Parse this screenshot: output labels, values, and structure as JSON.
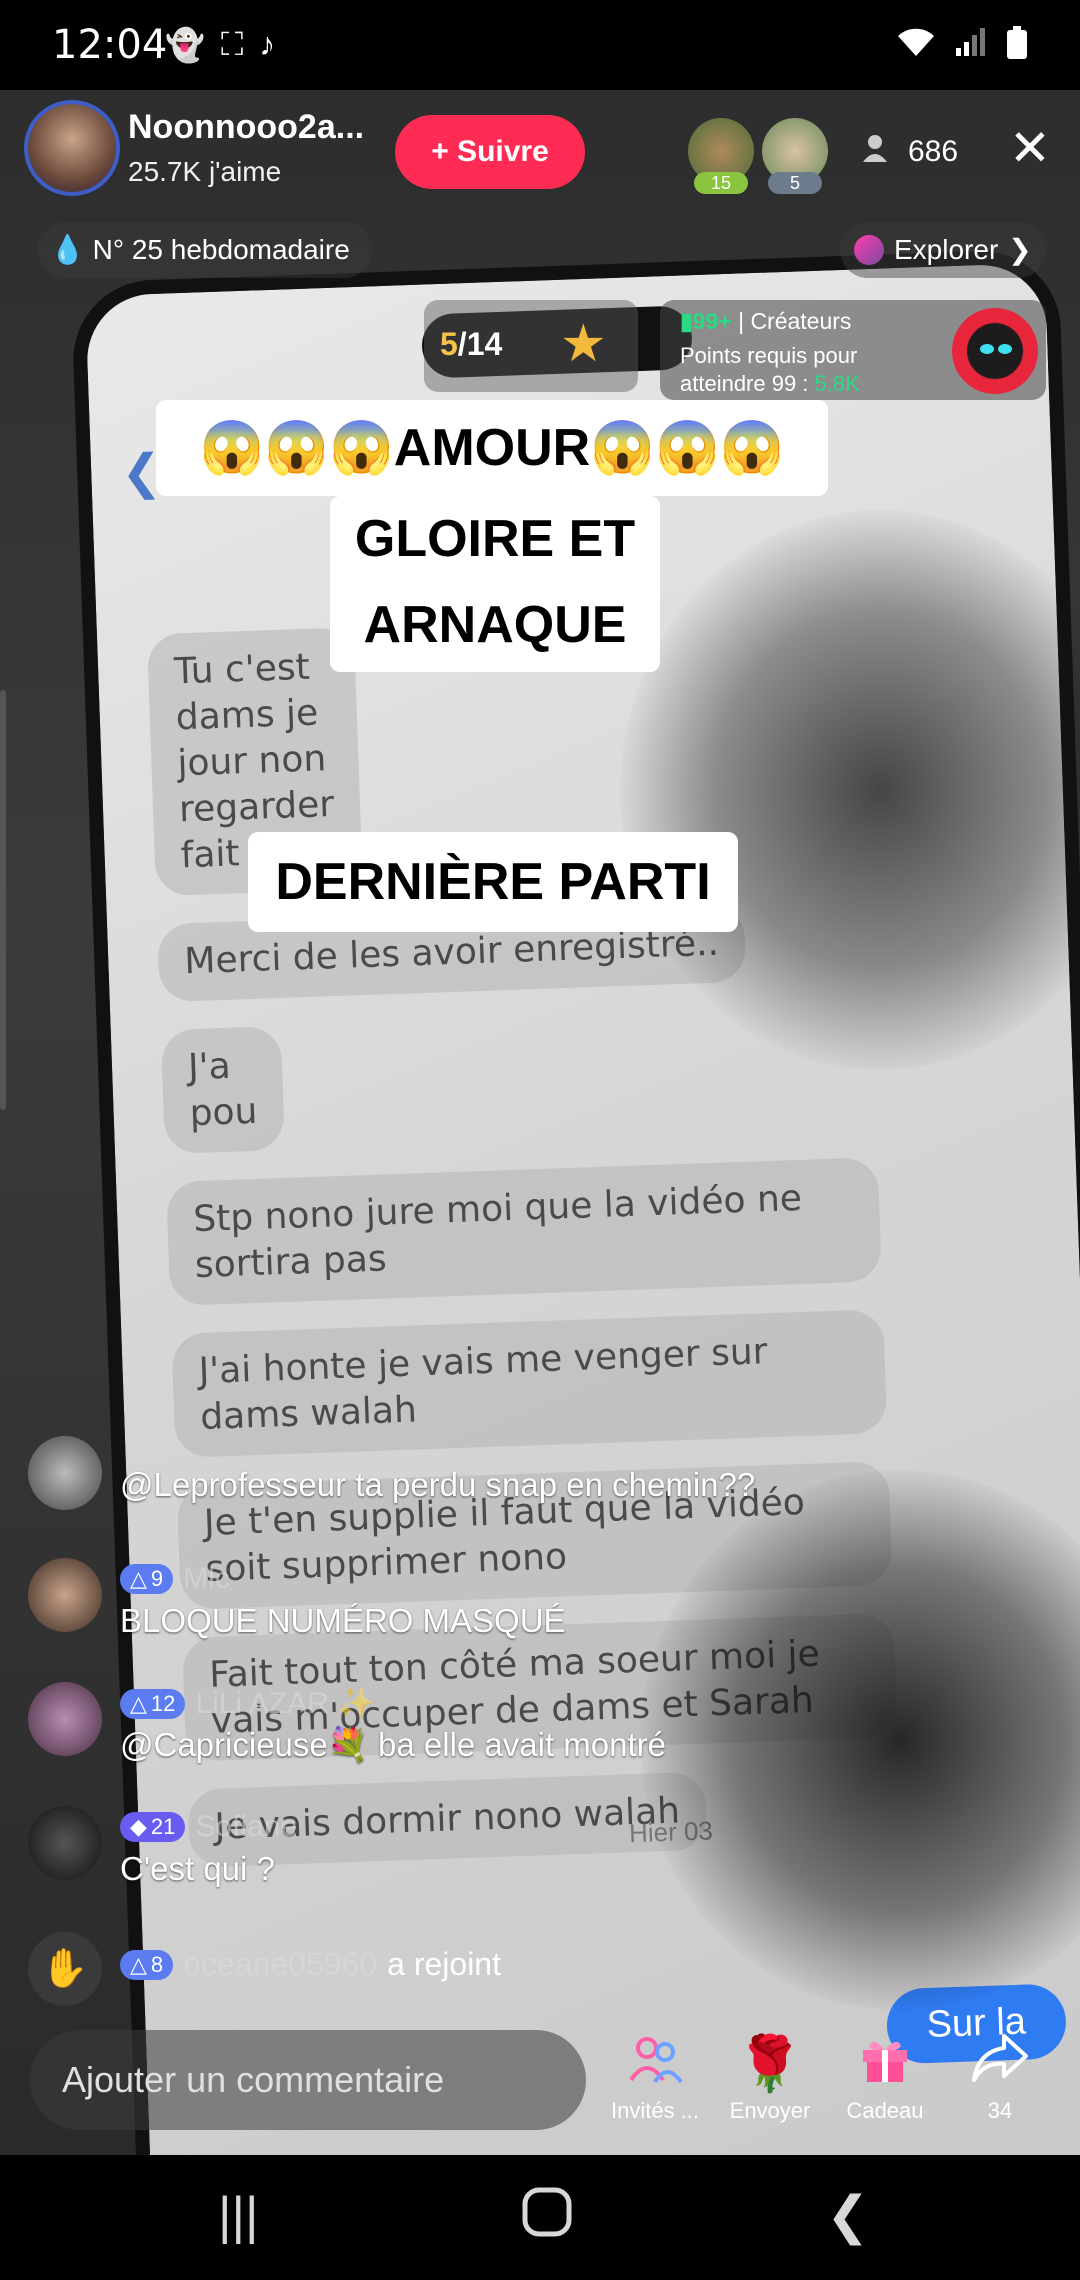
{
  "status_bar": {
    "time": "12:04",
    "icons_left": [
      "snapchat-icon",
      "screenshot-icon",
      "tiktok-icon"
    ],
    "icons_right": [
      "wifi-icon",
      "signal-icon",
      "battery-icon"
    ]
  },
  "host": {
    "name": "Noonnooo2a...",
    "likes": "25.7K j'aime",
    "follow_label": "+ Suivre"
  },
  "viewers": {
    "badges": [
      "15",
      "5"
    ],
    "count": "686"
  },
  "rank": {
    "label": "N° 25 hebdomadaire"
  },
  "explore": {
    "label": "Explorer"
  },
  "goal": {
    "current": "5",
    "total": "/14"
  },
  "creators_card": {
    "rank": "99+",
    "title": "| Créateurs",
    "line1": "Points requis pour",
    "line2_prefix": "atteindre 99 : ",
    "line2_value": "5.8K"
  },
  "captions": {
    "line1": "😱😱😱AMOUR😱😱😱",
    "line2a": "GLOIRE ET",
    "line2b": "ARNAQUE",
    "line3": "DERNIÈRE PARTI"
  },
  "screen_messages": [
    "Tu c'est",
    "dams je",
    "jour non",
    "regarder",
    "fait sa",
    "Merci de les avoir enregistré..",
    "J'a",
    "pou",
    "Stp nono jure moi que la vidéo ne sortira pas",
    "J'ai honte je vais me venger sur dams walah",
    "Je t'en supplie il faut que la vidéo soit supprimer nono",
    "Fait tout ton côté ma soeur moi je vais m'occuper de dams et Sarah",
    "Je vais dormir nono walah"
  ],
  "screen_date": "Hier 03",
  "screen_blue": "Sur la",
  "chat": [
    {
      "badge": "",
      "user": "",
      "text": "@Leprofesseur ta perdu snap en chemin??"
    },
    {
      "badge": "9",
      "user": "Mlc",
      "text": "BLOQUE NUMÉRO MASQUÉ"
    },
    {
      "badge": "12",
      "user": "LiLi AZAR ✨",
      "text": "@Capricieuse💐 ba elle avait montré"
    },
    {
      "badge": "21",
      "user": "Sofiane",
      "text": "C'est qui ?"
    },
    {
      "badge": "8",
      "user": "oceane05960",
      "text": "a rejoint"
    }
  ],
  "comment": {
    "placeholder": "Ajouter un commentaire"
  },
  "actions": [
    {
      "icon": "invite-icon",
      "label": "Invités ..."
    },
    {
      "icon": "rose-icon",
      "label": "Envoyer"
    },
    {
      "icon": "gift-icon",
      "label": "Cadeau"
    },
    {
      "icon": "share-icon",
      "label": "34"
    }
  ],
  "colors": {
    "follow": "#fe2c55",
    "green": "#2bd985",
    "badge_blue": "#5a7cf0",
    "goal_yellow": "#f8c24a"
  }
}
